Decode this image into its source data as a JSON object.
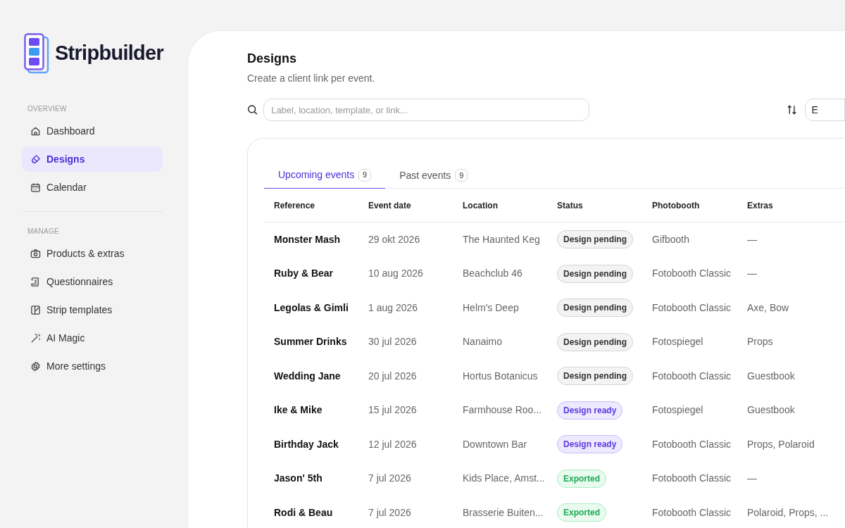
{
  "brand": "Stripbuilder",
  "sidebar": {
    "sections": [
      {
        "heading": "OVERVIEW",
        "items": [
          {
            "label": "Dashboard",
            "selected": false
          },
          {
            "label": "Designs",
            "selected": true
          },
          {
            "label": "Calendar",
            "selected": false
          }
        ]
      },
      {
        "heading": "MANAGE",
        "items": [
          {
            "label": "Products & extras",
            "selected": false
          },
          {
            "label": "Questionnaires",
            "selected": false
          },
          {
            "label": "Strip templates",
            "selected": false
          },
          {
            "label": "AI Magic",
            "selected": false
          },
          {
            "label": "More settings",
            "selected": false
          }
        ]
      }
    ]
  },
  "page": {
    "title": "Designs",
    "subtitle": "Create a client link per event."
  },
  "search": {
    "placeholder": "Label, location, template, or link..."
  },
  "sort_select": {
    "value": "E"
  },
  "tabs": [
    {
      "label": "Upcoming events",
      "count": "9",
      "selected": true
    },
    {
      "label": "Past events",
      "count": "9",
      "selected": false
    }
  ],
  "table": {
    "columns": [
      "Reference",
      "Event date",
      "Location",
      "Status",
      "Photobooth",
      "Extras"
    ],
    "rows": [
      {
        "reference": "Monster Mash",
        "date": "29 okt 2026",
        "location": "The Haunted Keg",
        "status": {
          "label": "Design pending",
          "kind": "pending"
        },
        "photobooth": "Gifbooth",
        "extras": "—"
      },
      {
        "reference": "Ruby & Bear",
        "date": "10 aug 2026",
        "location": "Beachclub 46",
        "status": {
          "label": "Design pending",
          "kind": "pending"
        },
        "photobooth": "Fotobooth Classic",
        "extras": "—"
      },
      {
        "reference": "Legolas & Gimli",
        "date": "1 aug 2026",
        "location": "Helm's Deep",
        "status": {
          "label": "Design pending",
          "kind": "pending"
        },
        "photobooth": "Fotobooth Classic",
        "extras": "Axe, Bow"
      },
      {
        "reference": "Summer Drinks",
        "date": "30 jul 2026",
        "location": "Nanaimo",
        "status": {
          "label": "Design pending",
          "kind": "pending"
        },
        "photobooth": "Fotospiegel",
        "extras": "Props"
      },
      {
        "reference": "Wedding Jane",
        "date": "20 jul 2026",
        "location": "Hortus Botanicus",
        "status": {
          "label": "Design pending",
          "kind": "pending"
        },
        "photobooth": "Fotobooth Classic",
        "extras": "Guestbook"
      },
      {
        "reference": "Ike & Mike",
        "date": "15 jul 2026",
        "location": "Farmhouse Roo...",
        "status": {
          "label": "Design ready",
          "kind": "ready"
        },
        "photobooth": "Fotospiegel",
        "extras": "Guestbook"
      },
      {
        "reference": "Birthday Jack",
        "date": "12 jul 2026",
        "location": "Downtown Bar",
        "status": {
          "label": "Design ready",
          "kind": "ready"
        },
        "photobooth": "Fotobooth Classic",
        "extras": "Props, Polaroid"
      },
      {
        "reference": "Jason' 5th",
        "date": "7 jul 2026",
        "location": "Kids Place, Amst...",
        "status": {
          "label": "Exported",
          "kind": "exported"
        },
        "photobooth": "Fotobooth Classic",
        "extras": "—"
      },
      {
        "reference": "Rodi & Beau",
        "date": "7 jul 2026",
        "location": "Brasserie Buiten...",
        "status": {
          "label": "Exported",
          "kind": "exported"
        },
        "photobooth": "Fotobooth Classic",
        "extras": "Polaroid, Props, ..."
      }
    ]
  }
}
